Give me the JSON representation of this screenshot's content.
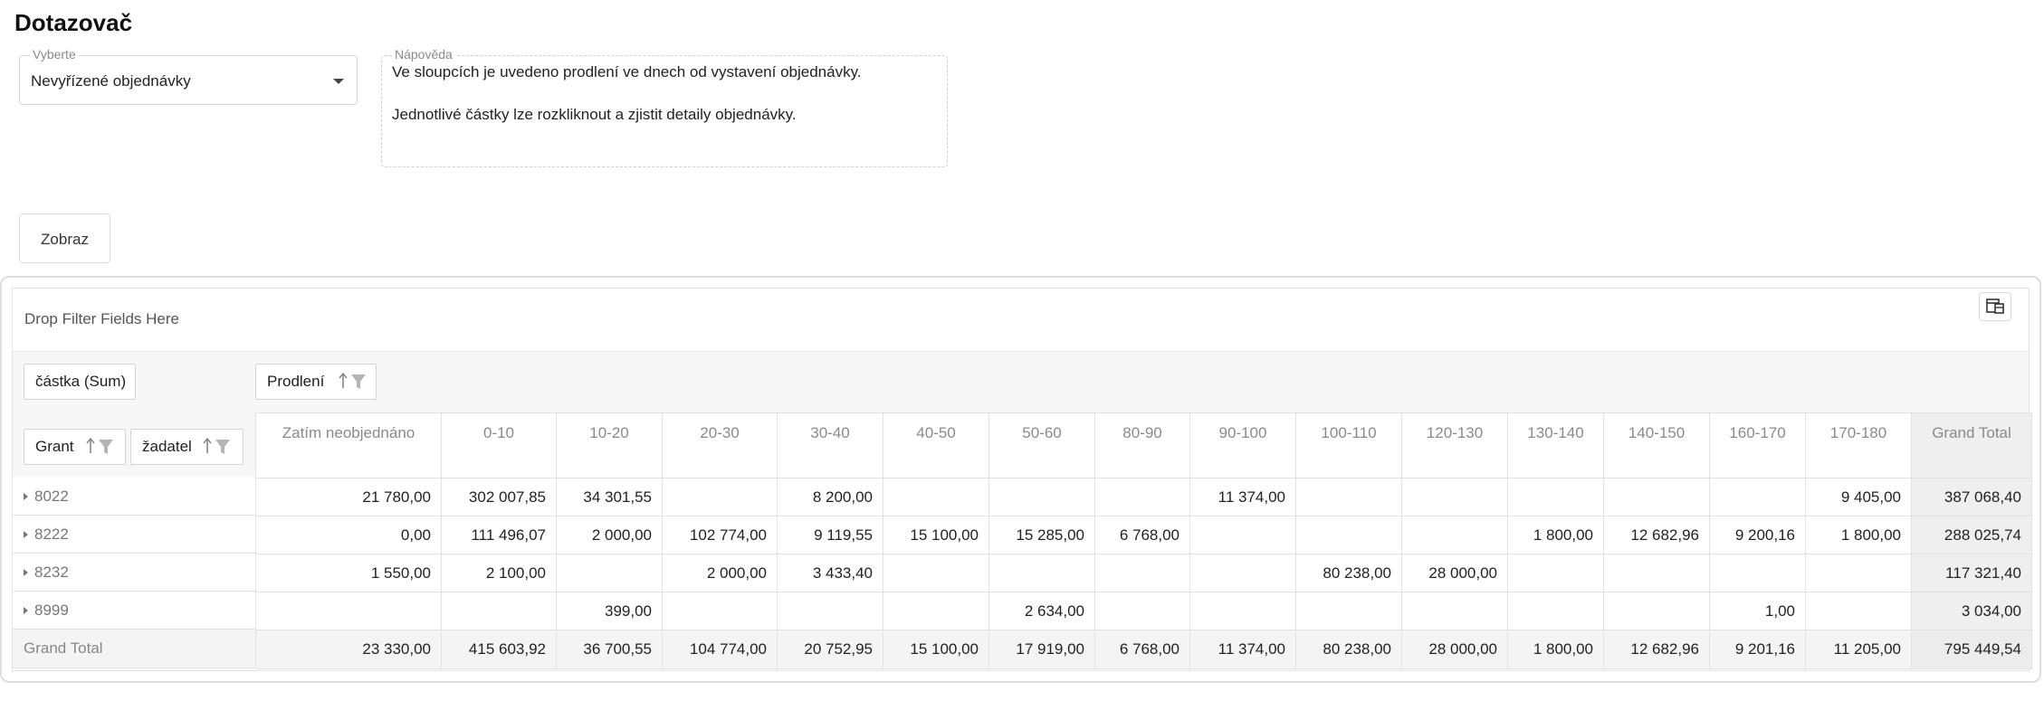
{
  "page": {
    "title": "Dotazovač"
  },
  "select": {
    "legend": "Vyberte",
    "value": "Nevyřízené objednávky"
  },
  "help": {
    "legend": "Nápověda",
    "line1": "Ve sloupcích je uvedeno prodlení ve dnech od vystavení objednávky.",
    "line2": "Jednotlivé částky lze rozkliknout a zjistit detaily objednávky."
  },
  "actions": {
    "show_label": "Zobraz"
  },
  "pivot": {
    "filter_placeholder": "Drop Filter Fields Here",
    "chooser_icon": "field-chooser-icon",
    "data_field": "částka (Sum)",
    "column_field": "Prodlení",
    "row_fields": [
      "Grant",
      "žadatel"
    ],
    "columns": [
      "Zatím neobjednáno",
      "0-10",
      "10-20",
      "20-30",
      "30-40",
      "40-50",
      "50-60",
      "80-90",
      "90-100",
      "100-110",
      "120-130",
      "130-140",
      "140-150",
      "160-170",
      "170-180",
      "Grand Total"
    ],
    "rows": [
      {
        "label": "8022",
        "cells": [
          "21 780,00",
          "302 007,85",
          "34 301,55",
          "",
          "8 200,00",
          "",
          "",
          "",
          "11 374,00",
          "",
          "",
          "",
          "",
          "",
          "9 405,00",
          "387 068,40"
        ]
      },
      {
        "label": "8222",
        "cells": [
          "0,00",
          "111 496,07",
          "2 000,00",
          "102 774,00",
          "9 119,55",
          "15 100,00",
          "15 285,00",
          "6 768,00",
          "",
          "",
          "",
          "1 800,00",
          "12 682,96",
          "9 200,16",
          "1 800,00",
          "288 025,74"
        ]
      },
      {
        "label": "8232",
        "cells": [
          "1 550,00",
          "2 100,00",
          "",
          "2 000,00",
          "3 433,40",
          "",
          "",
          "",
          "",
          "80 238,00",
          "28 000,00",
          "",
          "",
          "",
          "",
          "117 321,40"
        ]
      },
      {
        "label": "8999",
        "cells": [
          "",
          "",
          "399,00",
          "",
          "",
          "",
          "2 634,00",
          "",
          "",
          "",
          "",
          "",
          "",
          "1,00",
          "",
          "3 034,00"
        ]
      }
    ],
    "total": {
      "label": "Grand Total",
      "cells": [
        "23 330,00",
        "415 603,92",
        "36 700,55",
        "104 774,00",
        "20 752,95",
        "15 100,00",
        "17 919,00",
        "6 768,00",
        "11 374,00",
        "80 238,00",
        "28 000,00",
        "1 800,00",
        "12 682,96",
        "9 201,16",
        "11 205,00",
        "795 449,54"
      ]
    }
  }
}
